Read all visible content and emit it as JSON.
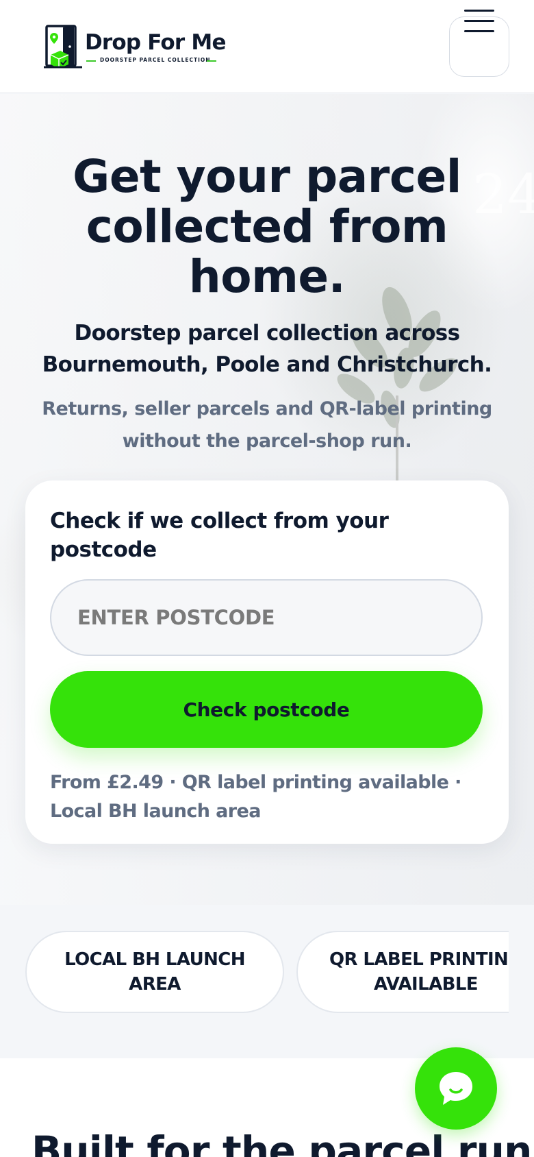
{
  "header": {
    "logo": {
      "name": "Drop For Me",
      "tagline": "DOORSTEP PARCEL COLLECTION",
      "icon": "door-parcel-logo-icon"
    },
    "menu_icon": "hamburger-menu-icon"
  },
  "hero": {
    "title": "Get your parcel collected from home.",
    "subtitle": "Doorstep parcel collection across Bournemouth, Poole and Christchurch.",
    "description": "Returns, seller parcels and QR-label printing without the parcel-shop run."
  },
  "postcode_card": {
    "title": "Check if we collect from your postcode",
    "input_placeholder": "ENTER POSTCODE",
    "input_value": "",
    "button_label": "Check postcode",
    "note": "From £2.49 · QR label printing available · Local BH launch area"
  },
  "pills": [
    {
      "label": "LOCAL BH LAUNCH AREA"
    },
    {
      "label": "QR LABEL PRINTING AVAILABLE"
    }
  ],
  "section": {
    "title": "Built for the parcel run"
  },
  "chat": {
    "icon": "chat-bubble-icon"
  },
  "colors": {
    "accent": "#35e20a",
    "navy": "#0f1a2e",
    "muted": "#5f6c81"
  }
}
